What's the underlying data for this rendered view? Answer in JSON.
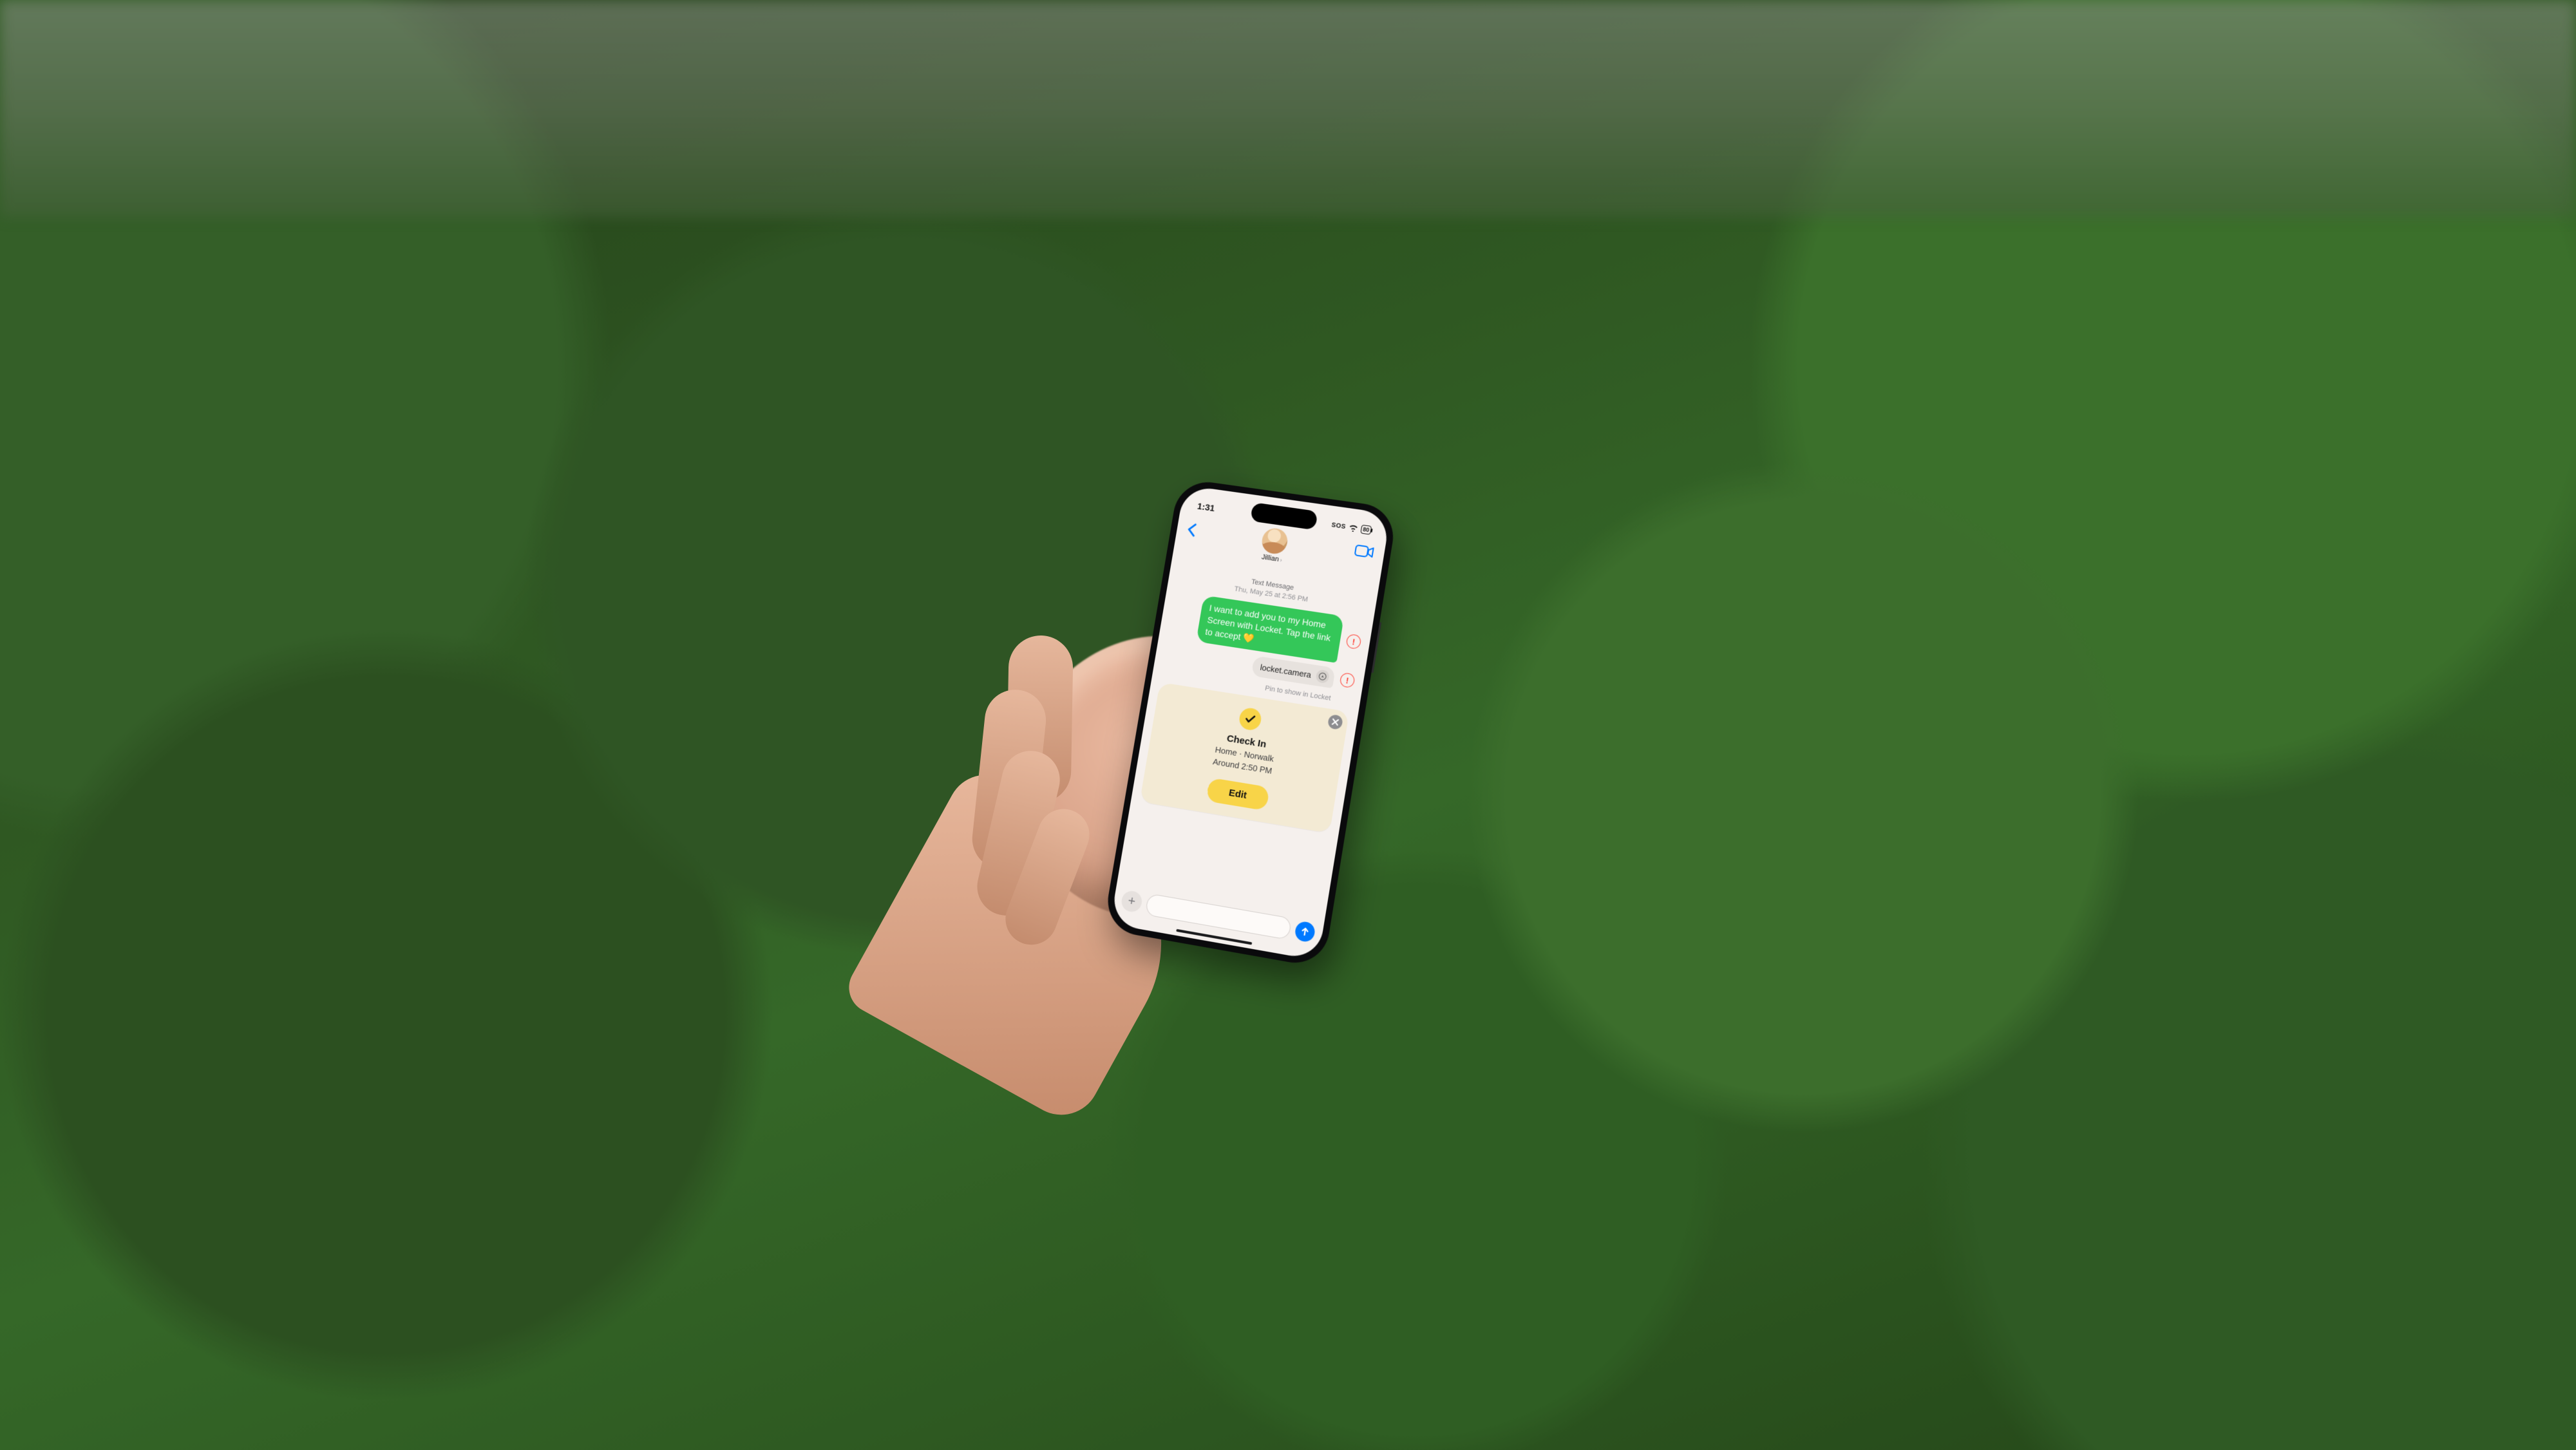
{
  "status_bar": {
    "time": "1:31",
    "sos": "SOS",
    "battery": "80"
  },
  "header": {
    "contact_name": "Jillian"
  },
  "thread": {
    "meta_line1": "Text Message",
    "meta_line2": "Thu, May 25 at 2:56 PM",
    "sent_message": "I want to add you to my Home Screen with Locket. Tap the link to accept 💛",
    "link_label": "locket.camera",
    "tapback_hint": "Pin to show in Locket"
  },
  "checkin": {
    "title": "Check In",
    "location_line": "Home · Norwalk",
    "time_line": "Around 2:50 PM",
    "edit_label": "Edit"
  },
  "colors": {
    "accent_blue": "#0079ff",
    "bubble_green": "#34c759",
    "checkin_yellow": "#f8d448",
    "error_red": "#ff3b30"
  }
}
